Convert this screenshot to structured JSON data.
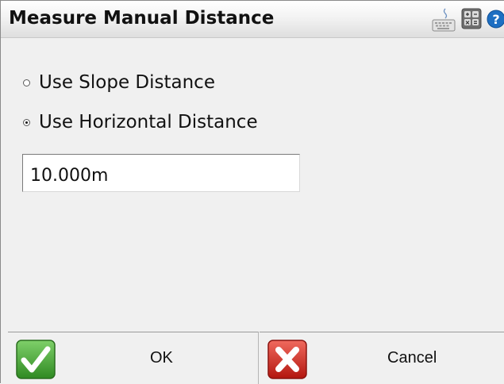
{
  "dialog": {
    "title": "Measure Manual Distance",
    "toolbar_icons": [
      "keyboard-icon",
      "calculator-icon",
      "help-icon"
    ]
  },
  "options": {
    "slope_label": "Use Slope Distance",
    "horizontal_label": "Use Horizontal Distance",
    "selected": "horizontal"
  },
  "distance": {
    "value": "10.000m"
  },
  "footer": {
    "ok_label": "OK",
    "cancel_label": "Cancel"
  },
  "colors": {
    "ok_icon": "#3e9a2c",
    "cancel_icon": "#c9201e",
    "help_icon": "#1e6fc2"
  }
}
